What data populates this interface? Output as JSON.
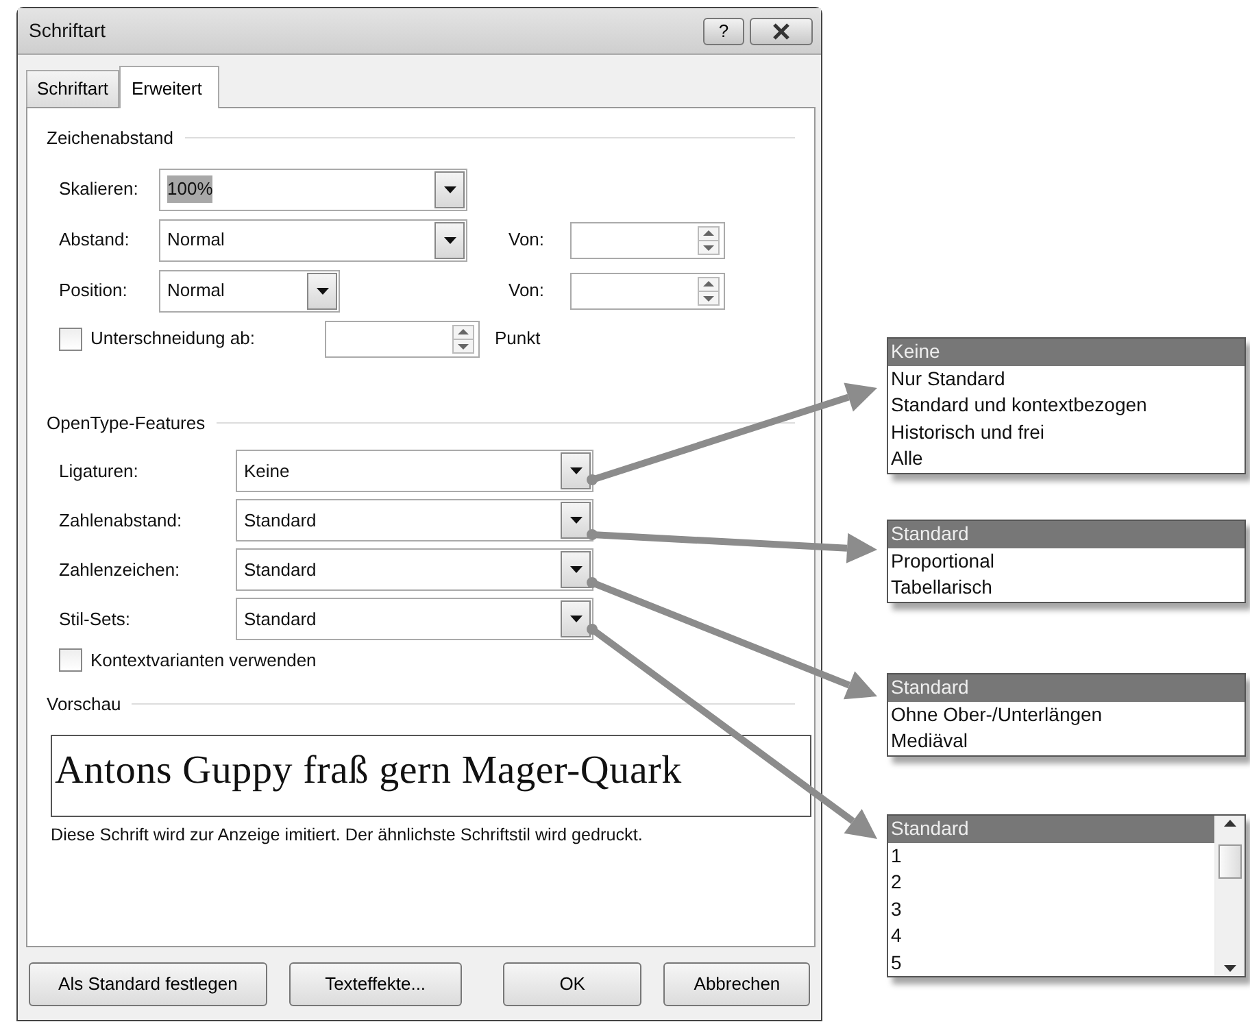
{
  "window": {
    "title": "Schriftart",
    "help_button": "?"
  },
  "tabs": [
    {
      "label": "Schriftart",
      "selected": false
    },
    {
      "label": "Erweitert",
      "selected": true
    }
  ],
  "character_spacing": {
    "heading": "Zeichenabstand",
    "scale": {
      "label": "Skalieren:",
      "value": "100%",
      "text_selected": true
    },
    "spacing": {
      "label": "Abstand:",
      "value": "Normal",
      "by_label": "Von:"
    },
    "position": {
      "label": "Position:",
      "value": "Normal",
      "by_label": "Von:"
    },
    "kerning": {
      "label": "Unterschneidung ab:",
      "checked": false,
      "unit": "Punkt"
    }
  },
  "opentype": {
    "heading": "OpenType-Features",
    "rows": [
      {
        "label": "Ligaturen:",
        "value": "Keine"
      },
      {
        "label": "Zahlenabstand:",
        "value": "Standard"
      },
      {
        "label": "Zahlenzeichen:",
        "value": "Standard"
      },
      {
        "label": "Stil-Sets:",
        "value": "Standard"
      }
    ],
    "contextual": {
      "label": "Kontextvarianten verwenden",
      "checked": false
    }
  },
  "preview": {
    "heading": "Vorschau",
    "sample": "Antons Guppy fraß gern Mager-Quark",
    "note": "Diese Schrift wird zur Anzeige imitiert. Der ähnlichste Schriftstil wird gedruckt."
  },
  "buttons": [
    {
      "label": "Als Standard festlegen"
    },
    {
      "label": "Texteffekte..."
    },
    {
      "label": "OK"
    },
    {
      "label": "Abbrechen"
    }
  ],
  "dropdown_lists": [
    {
      "kind": "plain",
      "items": [
        {
          "text": "Keine",
          "selected": true
        },
        {
          "text": "Nur Standard",
          "selected": false
        },
        {
          "text": "Standard und kontextbezogen",
          "selected": false
        },
        {
          "text": "Historisch und frei",
          "selected": false
        },
        {
          "text": "Alle",
          "selected": false
        }
      ]
    },
    {
      "kind": "plain",
      "items": [
        {
          "text": "Standard",
          "selected": true
        },
        {
          "text": "Proportional",
          "selected": false
        },
        {
          "text": "Tabellarisch",
          "selected": false
        }
      ]
    },
    {
      "kind": "plain",
      "items": [
        {
          "text": "Standard",
          "selected": true
        },
        {
          "text": "Ohne Ober-/Unterlängen",
          "selected": false
        },
        {
          "text": "Mediäval",
          "selected": false
        }
      ]
    },
    {
      "kind": "scrolling",
      "items": [
        {
          "text": "Standard",
          "selected": true
        },
        {
          "text": "1",
          "selected": false
        },
        {
          "text": "2",
          "selected": false
        },
        {
          "text": "3",
          "selected": false
        },
        {
          "text": "4",
          "selected": false
        },
        {
          "text": "5",
          "selected": false
        }
      ]
    }
  ]
}
